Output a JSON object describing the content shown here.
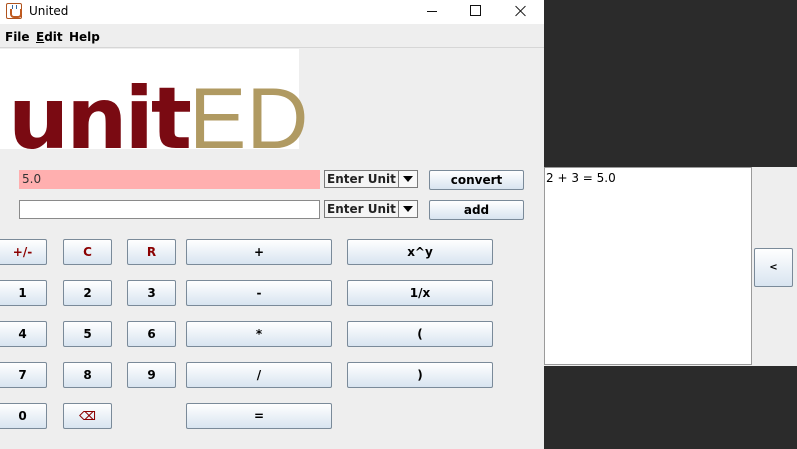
{
  "window": {
    "title": "United"
  },
  "menu": {
    "file": "File",
    "edit": "Edit",
    "help": "Help"
  },
  "logo": {
    "part1": "unit",
    "part2": "ED"
  },
  "converter": {
    "input_value": "5.0",
    "output_value": "",
    "unit1": "Enter Unit",
    "unit2": "Enter Unit",
    "convert_label": "convert",
    "add_label": "add"
  },
  "keypad": {
    "negate": "+/-",
    "clear": "C",
    "reset": "R",
    "plus": "+",
    "power": "x^y",
    "one": "1",
    "two": "2",
    "three": "3",
    "minus": "-",
    "reciprocal": "1/x",
    "four": "4",
    "five": "5",
    "six": "6",
    "multiply": "*",
    "open_paren": "(",
    "seven": "7",
    "eight": "8",
    "nine": "9",
    "divide": "/",
    "close_paren": ")",
    "zero": "0",
    "backspace": "⌫",
    "equals": "="
  },
  "history": {
    "lines": [
      "2 + 3 = 5.0"
    ],
    "collapse_label": "<"
  },
  "colors": {
    "error_field": "#ffafaf",
    "logo_red": "#7a0a12",
    "logo_gold": "#b09a62",
    "key_red": "#8b0000"
  }
}
